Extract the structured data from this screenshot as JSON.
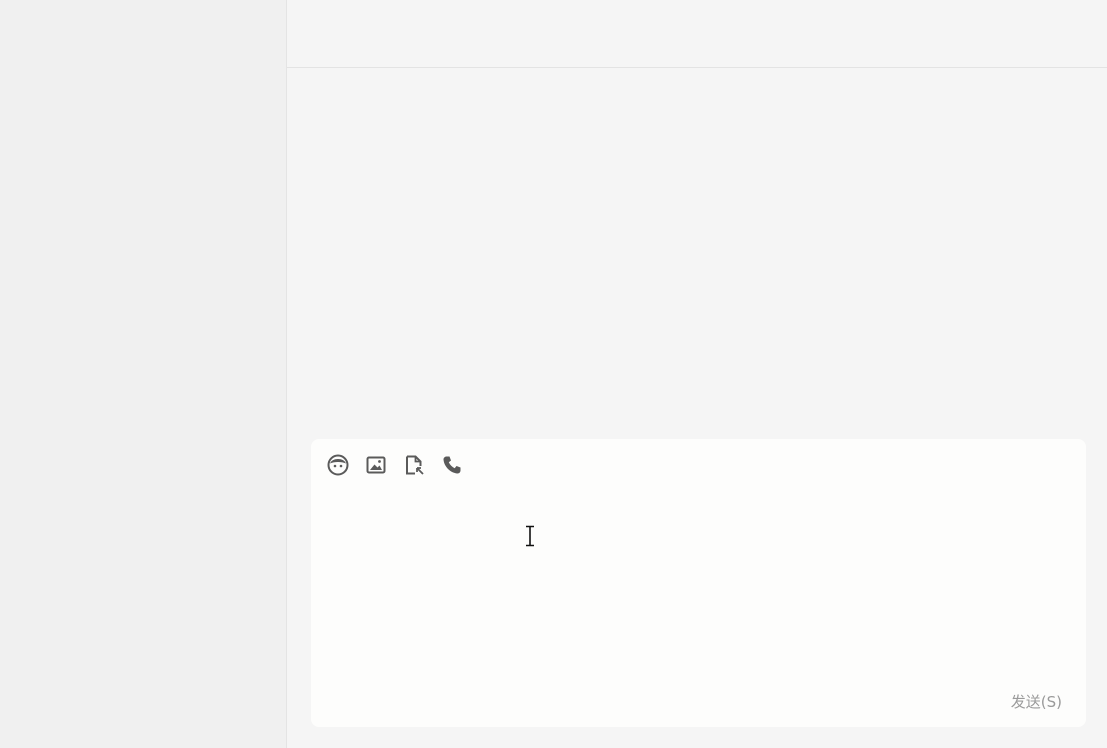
{
  "sidebar": {},
  "chat": {
    "header": {},
    "composer": {
      "toolbar": [
        {
          "icon": "emoji-icon"
        },
        {
          "icon": "image-icon"
        },
        {
          "icon": "file-icon"
        },
        {
          "icon": "phone-icon"
        }
      ],
      "input_value": "",
      "send_label": "发送(S)"
    }
  },
  "colors": {
    "sidebar_bg": "#f0f0f0",
    "main_bg": "#f5f5f5",
    "composer_bg": "#fdfdfc",
    "icon": "#5a5a5a",
    "send_text": "#9a9a9a"
  }
}
